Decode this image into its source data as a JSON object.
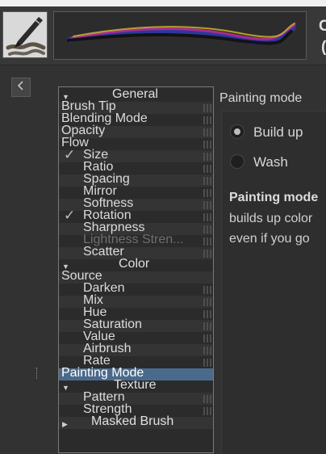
{
  "header": {
    "preset_name_fragment": "C",
    "preset_sub_fragment": "("
  },
  "option_list": {
    "rows": [
      {
        "label": "General",
        "type": "category",
        "expanded": true
      },
      {
        "label": "Brush Tip",
        "type": "item"
      },
      {
        "label": "Blending Mode",
        "type": "item"
      },
      {
        "label": "Opacity",
        "type": "item"
      },
      {
        "label": "Flow",
        "type": "item"
      },
      {
        "label": "Size",
        "type": "sub",
        "checked": true
      },
      {
        "label": "Ratio",
        "type": "sub"
      },
      {
        "label": "Spacing",
        "type": "sub"
      },
      {
        "label": "Mirror",
        "type": "sub"
      },
      {
        "label": "Softness",
        "type": "sub"
      },
      {
        "label": "Rotation",
        "type": "sub",
        "checked": true
      },
      {
        "label": "Sharpness",
        "type": "sub"
      },
      {
        "label": "Lightness Stren...",
        "type": "sub",
        "disabled": true
      },
      {
        "label": "Scatter",
        "type": "sub"
      },
      {
        "label": "Color",
        "type": "category",
        "expanded": true
      },
      {
        "label": "Source",
        "type": "item"
      },
      {
        "label": "Darken",
        "type": "sub"
      },
      {
        "label": "Mix",
        "type": "sub"
      },
      {
        "label": "Hue",
        "type": "sub"
      },
      {
        "label": "Saturation",
        "type": "sub"
      },
      {
        "label": "Value",
        "type": "sub"
      },
      {
        "label": "Airbrush",
        "type": "sub"
      },
      {
        "label": "Rate",
        "type": "sub"
      },
      {
        "label": "Painting Mode",
        "type": "item",
        "selected": true
      },
      {
        "label": "Texture",
        "type": "category",
        "expanded": true
      },
      {
        "label": "Pattern",
        "type": "sub"
      },
      {
        "label": "Strength",
        "type": "sub"
      },
      {
        "label": "Masked Brush",
        "type": "category",
        "expanded": false
      }
    ]
  },
  "panel": {
    "title": "Painting mode",
    "options": [
      {
        "label": "Build up",
        "checked": true
      },
      {
        "label": "Wash",
        "checked": false
      }
    ],
    "description_bold": "Painting mode",
    "description_lines": [
      "builds up color",
      "even if you go"
    ]
  },
  "colors": {
    "background": "#323232",
    "selection": "#4a6a8c"
  }
}
